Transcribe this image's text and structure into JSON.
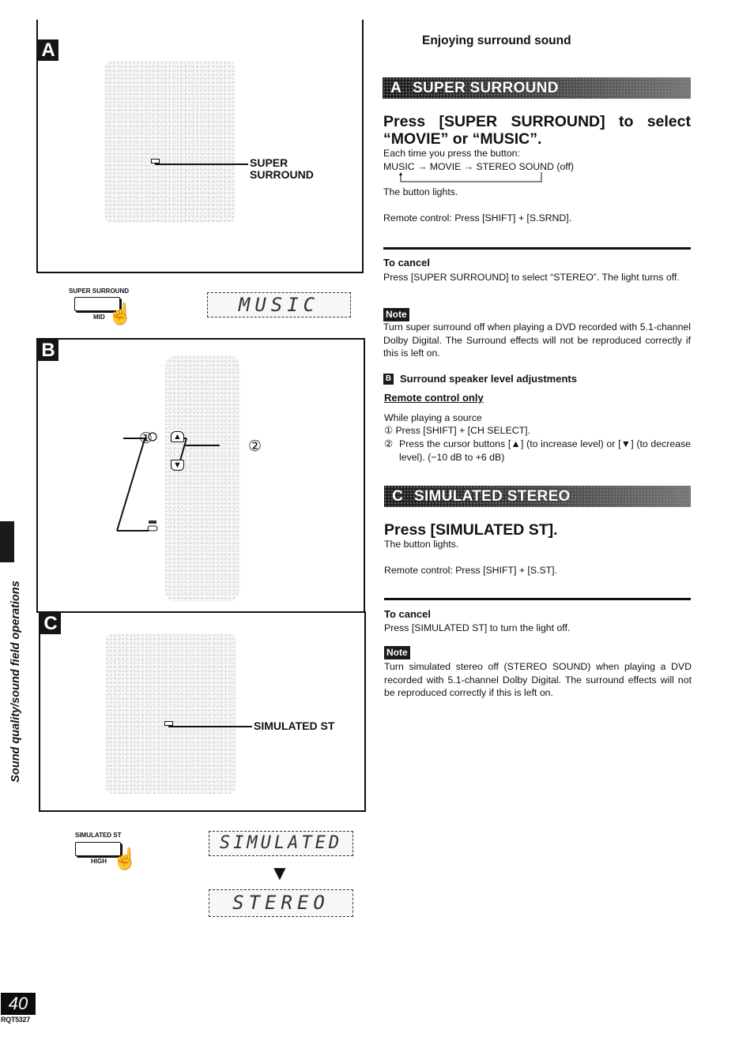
{
  "page": {
    "number": "40",
    "code": "RQT5327",
    "side_tab_text": "Sound quality/sound field operations",
    "header": "Enjoying surround sound"
  },
  "figures": {
    "A": {
      "letter": "A",
      "callout": [
        "SUPER",
        "SURROUND"
      ],
      "button_label": "SUPER SURROUND",
      "button_sub": "MID",
      "display": "MUSIC"
    },
    "B": {
      "letter": "B",
      "marker_1": "①",
      "marker_2": "②",
      "up_arrow": "▲",
      "down_arrow": "▼"
    },
    "C": {
      "letter": "C",
      "callout": "SIMULATED ST",
      "button_label": "SIMULATED ST",
      "button_sub": "HIGH",
      "display_1": "SIMULATED",
      "display_2": "STEREO",
      "arrow": "▼"
    }
  },
  "sections": {
    "A": {
      "letter": "A",
      "title": "SUPER SURROUND",
      "heading_line1": "Press [SUPER SURROUND] to select",
      "heading_line2": "“MOVIE” or “MUSIC”.",
      "each_time": "Each time you press the button:",
      "cycle": "MUSIC → MOVIE → STEREO SOUND (off)",
      "lights": "The button lights.",
      "remote": "Remote control: Press [SHIFT] + [S.SRND].",
      "cancel_head": "To cancel",
      "cancel_text": "Press [SUPER SURROUND] to select “STEREO”. The light turns off.",
      "note_label": "Note",
      "note_text": "Turn super surround off when playing a DVD recorded with 5.1-channel Dolby Digital. The Surround effects will not be reproduced correctly if this is left on."
    },
    "B": {
      "letter": "B",
      "title": "Surround speaker level adjustments",
      "sub": "Remote control only",
      "intro": "While playing a source",
      "step1_num": "①",
      "step1": "Press [SHIFT] + [CH SELECT].",
      "step2_num": "②",
      "step2": "Press the cursor buttons [▲] (to increase level) or [▼] (to decrease level). (−10 dB to +6 dB)"
    },
    "C": {
      "letter": "C",
      "title": "SIMULATED STEREO",
      "heading": "Press [SIMULATED ST].",
      "lights": "The button lights.",
      "remote": "Remote control:  Press [SHIFT] + [S.ST].",
      "cancel_head": "To cancel",
      "cancel_text": "Press [SIMULATED ST] to turn the light off.",
      "note_label": "Note",
      "note_text": "Turn simulated stereo off (STEREO SOUND) when playing a DVD recorded with 5.1-channel Dolby Digital. The surround effects will not be reproduced correctly if this is left on."
    }
  }
}
